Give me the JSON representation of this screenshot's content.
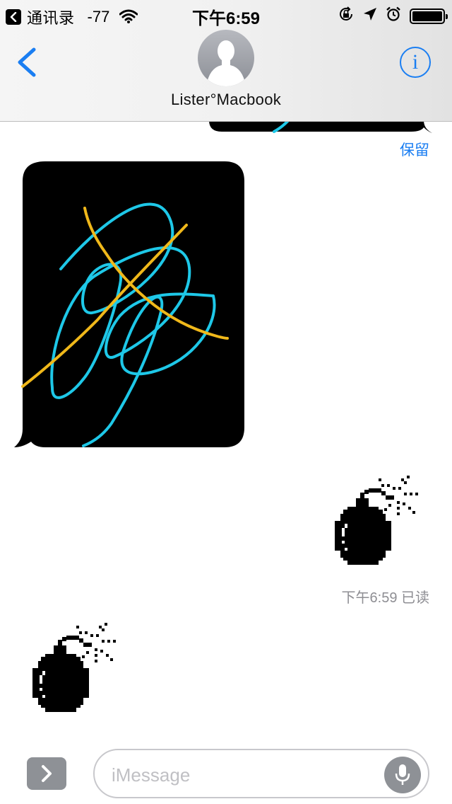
{
  "status_bar": {
    "back_app_label": "通讯录",
    "signal_strength": "-77",
    "time": "下午6:59",
    "battery_level": 1.0,
    "icons": [
      "back-badge-icon",
      "wifi-icon",
      "rotation-lock-icon",
      "location-arrow-icon",
      "alarm-icon",
      "battery-icon"
    ]
  },
  "header": {
    "back_icon": "chevron-left-icon",
    "avatar_icon": "person-silhouette-icon",
    "contact_name": "Lister°Macbook",
    "info_glyph": "i",
    "info_icon": "info-circle-icon"
  },
  "messages": [
    {
      "kind": "sketch",
      "direction": "sent",
      "partial": true,
      "action_label": "保留"
    },
    {
      "kind": "sketch",
      "direction": "received",
      "colors": [
        "#1ec8e8",
        "#f0b81a"
      ]
    },
    {
      "kind": "sticker",
      "direction": "sent",
      "icon": "bomb-icon"
    },
    {
      "kind": "sticker",
      "direction": "received",
      "icon": "bomb-icon"
    }
  ],
  "read_receipt": "下午6:59 已读",
  "input_bar": {
    "apps_icon": "chevron-right-icon",
    "placeholder": "iMessage",
    "value": "",
    "mic_icon": "microphone-icon"
  },
  "colors": {
    "accent": "#1a7ef2",
    "bubble": "#000000",
    "sketch_cyan": "#1ec8e8",
    "sketch_yellow": "#f0b81a",
    "muted": "#8e8e93"
  }
}
